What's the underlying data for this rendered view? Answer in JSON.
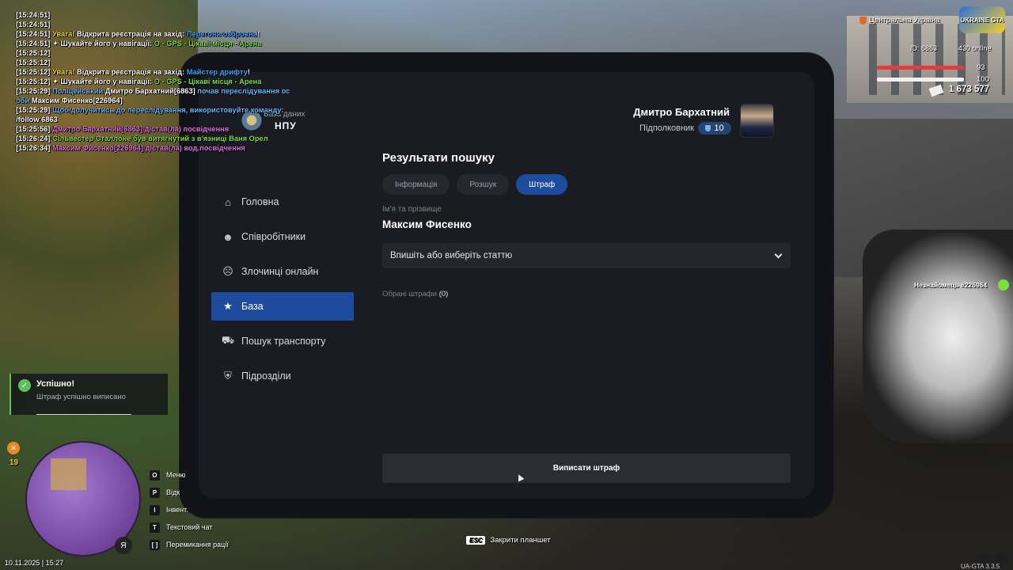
{
  "chat": [
    {
      "parts": [
        {
          "t": "[15:24:51]",
          "c": "w"
        }
      ]
    },
    {
      "parts": [
        {
          "t": "[15:24:51]",
          "c": "w"
        }
      ]
    },
    {
      "parts": [
        {
          "t": "[15:24:51] ",
          "c": "w"
        },
        {
          "t": "Увага! ",
          "c": "y"
        },
        {
          "t": "Відкрита реєстрація на захід: ",
          "c": "w"
        },
        {
          "t": "Перегони озброєнь",
          "c": "b"
        },
        {
          "t": "!",
          "c": "w"
        }
      ]
    },
    {
      "parts": [
        {
          "t": "[15:24:51] ",
          "c": "w"
        },
        {
          "t": "✦ Шукайте його у навігації: ",
          "c": "w"
        },
        {
          "t": "O - GPS - Цікаві місця - Арена",
          "c": "g"
        }
      ]
    },
    {
      "parts": [
        {
          "t": "[15:25:12]",
          "c": "w"
        }
      ]
    },
    {
      "parts": [
        {
          "t": "[15:25:12]",
          "c": "w"
        }
      ]
    },
    {
      "parts": [
        {
          "t": "[15:25:12] ",
          "c": "w"
        },
        {
          "t": "Увага! ",
          "c": "y"
        },
        {
          "t": "Відкрита реєстрація на захід: ",
          "c": "w"
        },
        {
          "t": "Майстер дрифту",
          "c": "b"
        },
        {
          "t": "!",
          "c": "w"
        }
      ]
    },
    {
      "parts": [
        {
          "t": "[15:25:12] ",
          "c": "w"
        },
        {
          "t": "✦ Шукайте його у навігації: ",
          "c": "w"
        },
        {
          "t": "O - GPS - Цікаві місця - Арена",
          "c": "g"
        }
      ]
    },
    {
      "parts": [
        {
          "t": "[15:25:29] ",
          "c": "w"
        },
        {
          "t": "Поліцейський ",
          "c": "lb"
        },
        {
          "t": "Дмитро Бархатний[6863] ",
          "c": "w"
        },
        {
          "t": "почав переслідування ос",
          "c": "lb"
        }
      ]
    },
    {
      "parts": [
        {
          "t": "оби ",
          "c": "lb"
        },
        {
          "t": "Максим Фисенко[226964]",
          "c": "w"
        }
      ]
    },
    {
      "parts": [
        {
          "t": "[15:25:29] ",
          "c": "w"
        },
        {
          "t": "Щоб долучитись до переслідування, використовуйте команду:",
          "c": "lb"
        }
      ]
    },
    {
      "parts": [
        {
          "t": "/follow 6863",
          "c": "w"
        }
      ]
    },
    {
      "parts": [
        {
          "t": "[15:25:56] ",
          "c": "w"
        },
        {
          "t": "Дмитро Бархатний[6863] дістав(ла) посвідчення",
          "c": "p"
        }
      ]
    },
    {
      "parts": [
        {
          "t": "[15:26:24] ",
          "c": "w"
        },
        {
          "t": "Сільвестер Сталлоне був витягнутий з в'язниці Ваня Орел",
          "c": "g"
        }
      ]
    },
    {
      "parts": [
        {
          "t": "[15:26:34] ",
          "c": "w"
        },
        {
          "t": "Максим Фисенко[226964] дістав(ла) вод.посвідчення",
          "c": "p"
        }
      ]
    }
  ],
  "hud": {
    "region": "Центральна Україна",
    "logo": "UKRAINE GTA",
    "id_text": "ID: 6863",
    "online_text": "430 online",
    "health": "93",
    "armor": "100",
    "money": "1 673 577",
    "npc_tag": "Незнайомець #226964"
  },
  "tablet": {
    "logo_sub": "База даних",
    "logo_main": "НПУ",
    "user": {
      "name": "Дмитро Бархатний",
      "rank": "Підполковник",
      "level": "10"
    },
    "nav": [
      {
        "icon": "home-icon",
        "glyph": "⌂",
        "label": "Головна",
        "active": false
      },
      {
        "icon": "employees-icon",
        "glyph": "☻",
        "label": "Співробітники",
        "active": false
      },
      {
        "icon": "criminals-icon",
        "glyph": "☹",
        "label": "Злочинці онлайн",
        "active": false
      },
      {
        "icon": "star-icon",
        "glyph": "★",
        "label": "База",
        "active": true
      },
      {
        "icon": "car-icon",
        "glyph": "⛟",
        "label": "Пошук транспорту",
        "active": false
      },
      {
        "icon": "shield-icon",
        "glyph": "⛨",
        "label": "Підрозділи",
        "active": false
      }
    ],
    "content": {
      "title": "Результати пошуку",
      "tabs": [
        {
          "label": "Інформація",
          "active": false
        },
        {
          "label": "Розшук",
          "active": false
        },
        {
          "label": "Штраф",
          "active": true
        }
      ],
      "name_label": "Ім'я та прізвище",
      "name_value": "Максим Фисенко",
      "select_placeholder": "Впишіть або виберіть статтю",
      "chosen_label": "Обрані штрафи",
      "chosen_count": "(0)",
      "submit_label": "Виписати штраф"
    }
  },
  "notification": {
    "title": "Успішно!",
    "text": "Штраф успішно виписано"
  },
  "hints": [
    {
      "key": "O",
      "label": "Меню"
    },
    {
      "key": "P",
      "label": "Відк"
    },
    {
      "key": "I",
      "label": "Інвент."
    },
    {
      "key": "T",
      "label": "Текстовий чат"
    },
    {
      "key": "[ ]",
      "label": "Перемикання рації"
    }
  ],
  "hunger_value": "19",
  "mic_label": "Я",
  "datetime": "10.11.2025 | 15:27",
  "esc": {
    "key": "ESC",
    "label": "Закрити планшет"
  },
  "version": "UA-GTA 3.3.5"
}
